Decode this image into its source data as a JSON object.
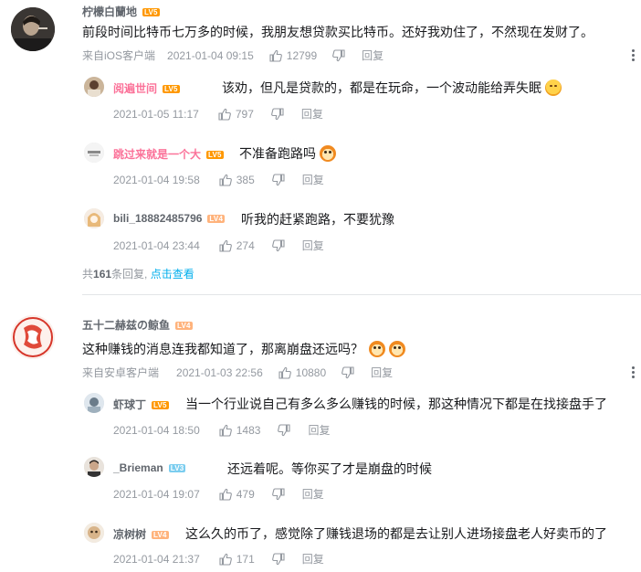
{
  "threads": [
    {
      "user": {
        "name": "柠檬白蘭地",
        "level": "LV5"
      },
      "text": "前段时间比特币七万多的时候，我朋友想贷款买比特币。还好我劝住了，不然现在发财了。",
      "source": "来自iOS客户端",
      "time": "2021-01-04 09:15",
      "likes": "12799",
      "reply_label": "回复",
      "replies": [
        {
          "name": "阅遍世间",
          "level": "LV5",
          "text": "该劝，但凡是贷款的，都是在玩命，一个波动能给弄失眠",
          "emoji": "face-emoji",
          "time": "2021-01-05 11:17",
          "likes": "797",
          "reply_label": "回复",
          "name_color": "#fb7299"
        },
        {
          "name": "跳过来就是一个大",
          "level": "LV5",
          "text": "不准备跑路吗",
          "emoji": "dog-emoji",
          "time": "2021-01-04 19:58",
          "likes": "385",
          "reply_label": "回复",
          "name_color": "#fb7299"
        },
        {
          "name": "bili_18882485796",
          "level": "LV4",
          "text": "听我的赶紧跑路，不要犹豫",
          "emoji": "",
          "time": "2021-01-04 23:44",
          "likes": "274",
          "reply_label": "回复",
          "name_color": "#61666d"
        }
      ],
      "summary": {
        "prefix": "共",
        "count": "161",
        "suffix": "条回复,",
        "link": "点击查看"
      }
    },
    {
      "user": {
        "name": "五十二赫兹の鲸鱼",
        "level": "LV4"
      },
      "text": "这种赚钱的消息连我都知道了，那离崩盘还远吗？",
      "source": "来自安卓客户端",
      "time": "2021-01-03 22:56",
      "likes": "10880",
      "reply_label": "回复",
      "replies": [
        {
          "name": "虾球丁",
          "level": "LV5",
          "text": "当一个行业说自己有多么多么赚钱的时候，那这种情况下都是在找接盘手了",
          "emoji": "",
          "time": "2021-01-04 18:50",
          "likes": "1483",
          "reply_label": "回复",
          "name_color": "#61666d"
        },
        {
          "name": "_Brieman",
          "level": "LV3",
          "text": "还远着呢。等你买了才是崩盘的时候",
          "emoji": "",
          "time": "2021-01-04 19:07",
          "likes": "479",
          "reply_label": "回复",
          "name_color": "#61666d"
        },
        {
          "name": "凉树树",
          "level": "LV4",
          "text": "这么久的币了，感觉除了赚钱退场的都是去让别人进场接盘老人好卖币的了",
          "emoji": "",
          "time": "2021-01-04 21:37",
          "likes": "171",
          "reply_label": "回复",
          "name_color": "#61666d"
        }
      ]
    }
  ],
  "colors": {
    "link": "#00aeec",
    "meta": "#9499a0",
    "vip_name": "#fb7299",
    "lv5": "#ff9800",
    "lv4": "#ffb37c",
    "lv3": "#7bcdef"
  }
}
